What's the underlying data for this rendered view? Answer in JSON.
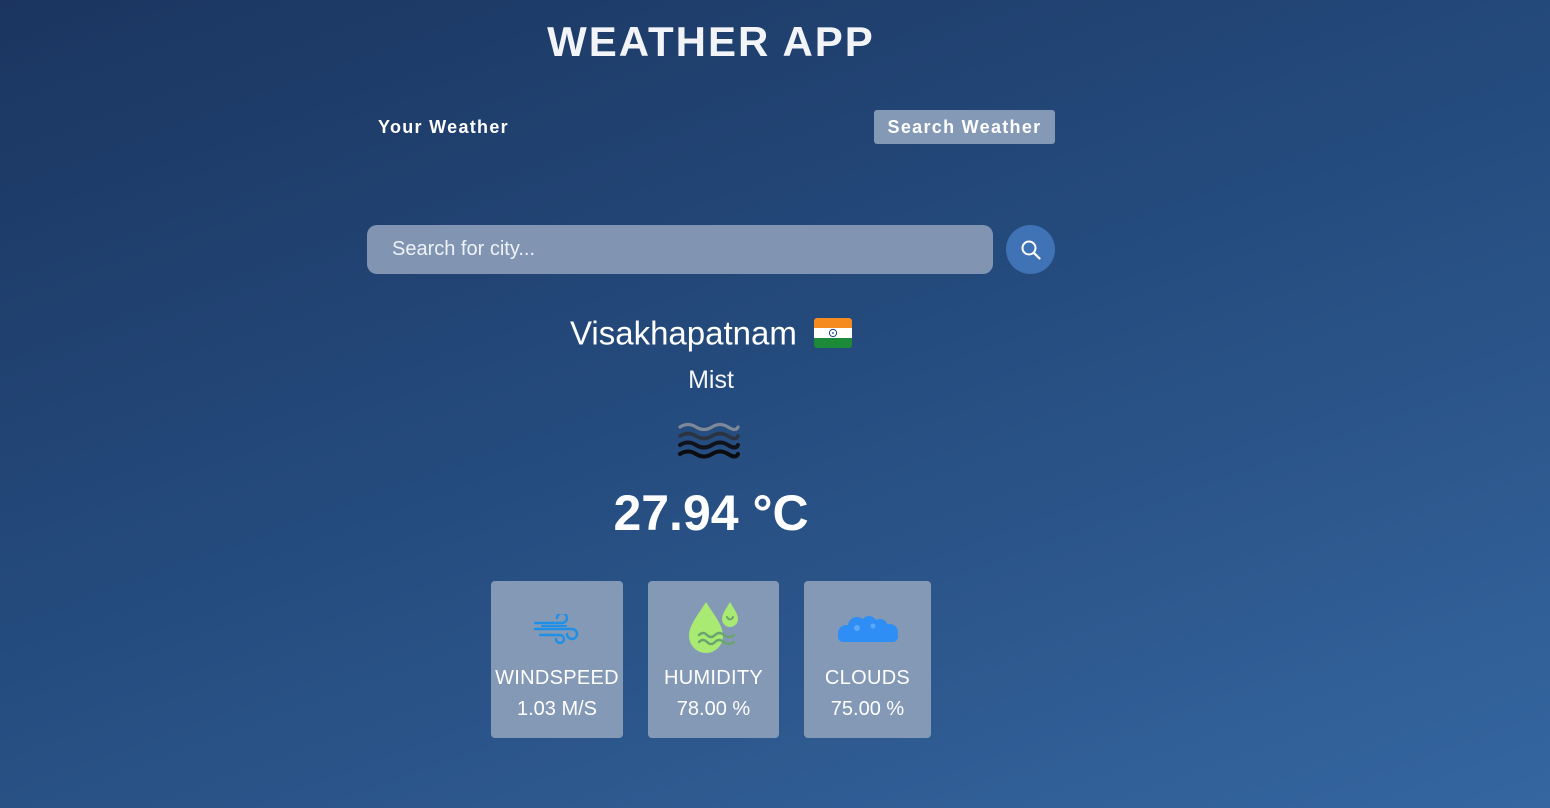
{
  "app": {
    "title": "WEATHER APP"
  },
  "tabs": {
    "your_weather": "Your Weather",
    "search_weather": "Search Weather",
    "active": "Search Weather"
  },
  "search": {
    "placeholder": "Search for city...",
    "value": "",
    "button_icon": "search-icon"
  },
  "weather": {
    "city": "Visakhapatnam",
    "country_flag_icon": "india-flag-icon",
    "condition": "Mist",
    "condition_icon": "mist-icon",
    "temperature": "27.94 °C"
  },
  "stats": [
    {
      "label": "WINDSPEED",
      "value": "1.03 M/S",
      "icon": "wind-icon"
    },
    {
      "label": "HUMIDITY",
      "value": "78.00 %",
      "icon": "humidity-icon"
    },
    {
      "label": "CLOUDS",
      "value": "75.00 %",
      "icon": "clouds-icon"
    }
  ],
  "colors": {
    "background_start": "#1b3560",
    "background_end": "#3566a0",
    "panel": "#8499b6",
    "search_button": "#3f73b5",
    "wind_icon": "#1e90e8",
    "humidity_icon": "#a8ea72",
    "clouds_icon": "#2f8ef5"
  }
}
